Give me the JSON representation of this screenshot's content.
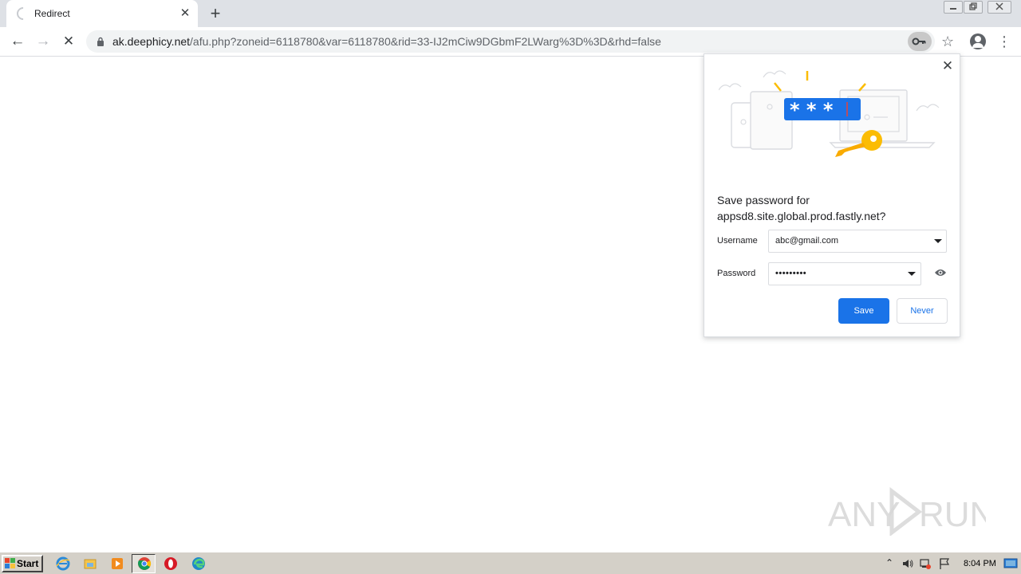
{
  "browser": {
    "tab": {
      "title": "Redirect",
      "close_glyph": "✕",
      "icon": "loading-spinner-icon"
    },
    "newtab_glyph": "+",
    "window_controls": [
      "minimize-icon",
      "restore-icon",
      "close-icon"
    ],
    "nav": {
      "back_glyph": "←",
      "forward_glyph": "→",
      "stop_glyph": "✕"
    },
    "address": {
      "host": "ak.deephicy.net",
      "path": "/afu.php?zoneid=6118780&var=6118780&rid=33-IJ2mCiw9DGbmF2LWarg%3D%3D&rhd=false",
      "icons": [
        "lock-icon",
        "key-icon",
        "star-icon"
      ]
    },
    "menu_glyph": "⋮"
  },
  "password_bubble": {
    "close_glyph": "✕",
    "question_line1": "Save password for",
    "question_line2": "appsd8.site.global.prod.fastly.net?",
    "username_label": "Username",
    "username_value": "abc@gmail.com",
    "password_label": "Password",
    "password_value": "•••••••••",
    "save_label": "Save",
    "never_label": "Never",
    "illustration": "password-save-illustration",
    "colors": {
      "accent": "#1a73e8",
      "key": "#fbbc04"
    }
  },
  "watermark": {
    "text_left": "ANY",
    "text_right": "RUN"
  },
  "taskbar": {
    "start_label": "Start",
    "apps": [
      "internet-explorer-icon",
      "file-explorer-icon",
      "media-player-icon",
      "chrome-icon",
      "opera-icon",
      "edge-icon"
    ],
    "tray_icons": [
      "chevron-up-icon",
      "volume-icon",
      "network-icon",
      "flag-icon",
      "show-desktop-icon"
    ],
    "clock": "8:04 PM"
  }
}
